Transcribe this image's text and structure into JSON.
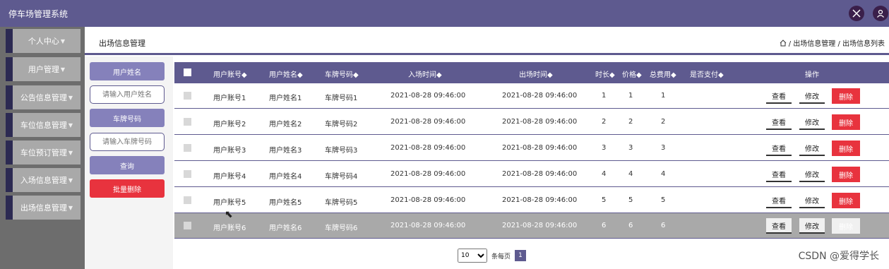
{
  "app": {
    "title": "停车场管理系统"
  },
  "top_icons": [
    "fullscreen-icon",
    "user-icon"
  ],
  "sidebar": {
    "items": [
      {
        "label": "个人中心"
      },
      {
        "label": "用户管理"
      },
      {
        "label": "公告信息管理"
      },
      {
        "label": "车位信息管理"
      },
      {
        "label": "车位预订管理"
      },
      {
        "label": "入场信息管理"
      },
      {
        "label": "出场信息管理"
      }
    ]
  },
  "header": {
    "title": "出场信息管理",
    "breadcrumb": "/ 出场信息管理 / 出场信息列表"
  },
  "filter": {
    "username_label": "用户姓名",
    "username_placeholder": "请输入用户姓名",
    "plate_label": "车牌号码",
    "plate_placeholder": "请输入车牌号码",
    "query_label": "查询",
    "batch_delete_label": "批量删除"
  },
  "table": {
    "headers": [
      "用户账号◆",
      "用户姓名◆",
      "车牌号码◆",
      "入场时间◆",
      "出场时间◆",
      "时长◆",
      "价格◆",
      "总费用◆",
      "是否支付◆",
      "操作"
    ],
    "rows": [
      [
        "用户账号1",
        "用户姓名1",
        "车牌号码1",
        "2021-08-28 09:46:00",
        "2021-08-28 09:46:00",
        "1",
        "1",
        "1",
        ""
      ],
      [
        "用户账号2",
        "用户姓名2",
        "车牌号码2",
        "2021-08-28 09:46:00",
        "2021-08-28 09:46:00",
        "2",
        "2",
        "2",
        ""
      ],
      [
        "用户账号3",
        "用户姓名3",
        "车牌号码3",
        "2021-08-28 09:46:00",
        "2021-08-28 09:46:00",
        "3",
        "3",
        "3",
        ""
      ],
      [
        "用户账号4",
        "用户姓名4",
        "车牌号码4",
        "2021-08-28 09:46:00",
        "2021-08-28 09:46:00",
        "4",
        "4",
        "4",
        ""
      ],
      [
        "用户账号5",
        "用户姓名5",
        "车牌号码5",
        "2021-08-28 09:46:00",
        "2021-08-28 09:46:00",
        "5",
        "5",
        "5",
        ""
      ],
      [
        "用户账号6",
        "用户姓名6",
        "车牌号码6",
        "2021-08-28 09:46:00",
        "2021-08-28 09:46:00",
        "6",
        "6",
        "6",
        ""
      ]
    ],
    "actions": {
      "view": "查看",
      "edit": "修改",
      "delete": "删除"
    }
  },
  "pagination": {
    "page_size": "10",
    "per_page_label": "条每页",
    "current_page": "1"
  },
  "watermark": "CSDN @爱得学长",
  "colors": {
    "primary": "#5e5a8f",
    "danger": "#e8333e",
    "sidebar_bg": "#6d6d6d"
  }
}
